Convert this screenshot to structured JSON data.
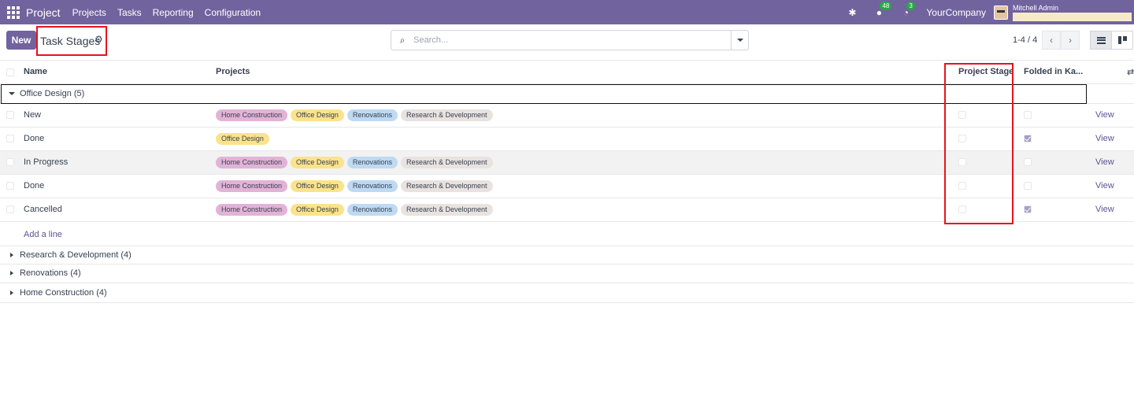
{
  "topbar": {
    "app_name": "Project",
    "menu": [
      "Projects",
      "Tasks",
      "Reporting",
      "Configuration"
    ],
    "messages_count": "48",
    "activities_count": "3",
    "company": "YourCompany",
    "user_name": "Mitchell Admin"
  },
  "control_panel": {
    "new_label": "New",
    "title": "Task Stages",
    "search_placeholder": "Search...",
    "pager": "1-4 / 4"
  },
  "columns": {
    "name": "Name",
    "projects": "Projects",
    "project_stage": "Project Stage",
    "folded": "Folded in Ka..."
  },
  "tag_colors": {
    "Home Construction": "#e2b3d6",
    "Office Design": "#fbe38c",
    "Renovations": "#bedaf3",
    "Research & Development": "#e9e2df"
  },
  "open_group": {
    "label": "Office Design (5)",
    "rows": [
      {
        "name": "New",
        "projects": [
          "Home Construction",
          "Office Design",
          "Renovations",
          "Research & Development"
        ],
        "project_stage": false,
        "folded": false,
        "view": "View"
      },
      {
        "name": "Done",
        "projects": [
          "Office Design"
        ],
        "project_stage": false,
        "folded": true,
        "view": "View"
      },
      {
        "name": "In Progress",
        "projects": [
          "Home Construction",
          "Office Design",
          "Renovations",
          "Research & Development"
        ],
        "project_stage": false,
        "folded": false,
        "view": "View"
      },
      {
        "name": "Done",
        "projects": [
          "Home Construction",
          "Office Design",
          "Renovations",
          "Research & Development"
        ],
        "project_stage": false,
        "folded": false,
        "view": "View"
      },
      {
        "name": "Cancelled",
        "projects": [
          "Home Construction",
          "Office Design",
          "Renovations",
          "Research & Development"
        ],
        "project_stage": false,
        "folded": true,
        "view": "View"
      }
    ],
    "add_line": "Add a line"
  },
  "collapsed_groups": [
    {
      "label": "Research & Development (4)"
    },
    {
      "label": "Renovations (4)"
    },
    {
      "label": "Home Construction (4)"
    }
  ]
}
